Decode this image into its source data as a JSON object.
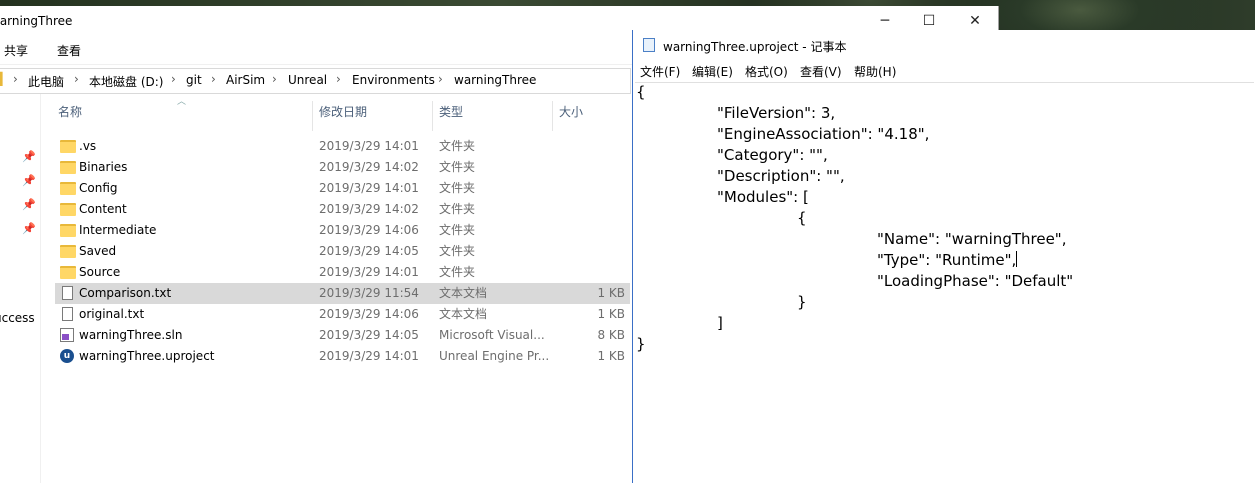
{
  "explorer": {
    "title": "warningThree",
    "ribbon_tabs": [
      "共享",
      "查看"
    ],
    "breadcrumbs": [
      "此电脑",
      "本地磁盘 (D:)",
      "git",
      "AirSim",
      "Unreal",
      "Environments",
      "warningThree"
    ],
    "nav_text": "uccess",
    "columns": {
      "name": "名称",
      "date": "修改日期",
      "type": "类型",
      "size": "大小"
    },
    "files": [
      {
        "name": ".vs",
        "date": "2019/3/29 14:01",
        "type": "文件夹",
        "size": "",
        "icon": "folder-icon"
      },
      {
        "name": "Binaries",
        "date": "2019/3/29 14:02",
        "type": "文件夹",
        "size": "",
        "icon": "folder-icon"
      },
      {
        "name": "Config",
        "date": "2019/3/29 14:01",
        "type": "文件夹",
        "size": "",
        "icon": "folder-icon"
      },
      {
        "name": "Content",
        "date": "2019/3/29 14:02",
        "type": "文件夹",
        "size": "",
        "icon": "folder-icon"
      },
      {
        "name": "Intermediate",
        "date": "2019/3/29 14:06",
        "type": "文件夹",
        "size": "",
        "icon": "folder-icon"
      },
      {
        "name": "Saved",
        "date": "2019/3/29 14:05",
        "type": "文件夹",
        "size": "",
        "icon": "folder-icon"
      },
      {
        "name": "Source",
        "date": "2019/3/29 14:01",
        "type": "文件夹",
        "size": "",
        "icon": "folder-icon"
      },
      {
        "name": "Comparison.txt",
        "date": "2019/3/29 11:54",
        "type": "文本文档",
        "size": "1 KB",
        "icon": "text-file-icon",
        "selected": true
      },
      {
        "name": "original.txt",
        "date": "2019/3/29 14:06",
        "type": "文本文档",
        "size": "1 KB",
        "icon": "text-file-icon"
      },
      {
        "name": "warningThree.sln",
        "date": "2019/3/29 14:05",
        "type": "Microsoft Visual...",
        "size": "8 KB",
        "icon": "visual-studio-solution-icon"
      },
      {
        "name": "warningThree.uproject",
        "date": "2019/3/29 14:01",
        "type": "Unreal Engine Pr...",
        "size": "1 KB",
        "icon": "unreal-engine-icon"
      }
    ],
    "window_buttons": {
      "minimize": "─",
      "maximize": "☐",
      "close": "✕"
    }
  },
  "notepad": {
    "title": "warningThree.uproject - 记事本",
    "menu": [
      "文件(F)",
      "编辑(E)",
      "格式(O)",
      "查看(V)",
      "帮助(H)"
    ],
    "lines": [
      "{",
      "\"FileVersion\": 3,",
      "\"EngineAssociation\": \"4.18\",",
      "\"Category\": \"\",",
      "\"Description\": \"\",",
      "\"Modules\": [",
      "{",
      "\"Name\": \"warningThree\",",
      "\"Type\": \"Runtime\",",
      "\"LoadingPhase\": \"Default\"",
      "}",
      "]",
      "}"
    ]
  }
}
